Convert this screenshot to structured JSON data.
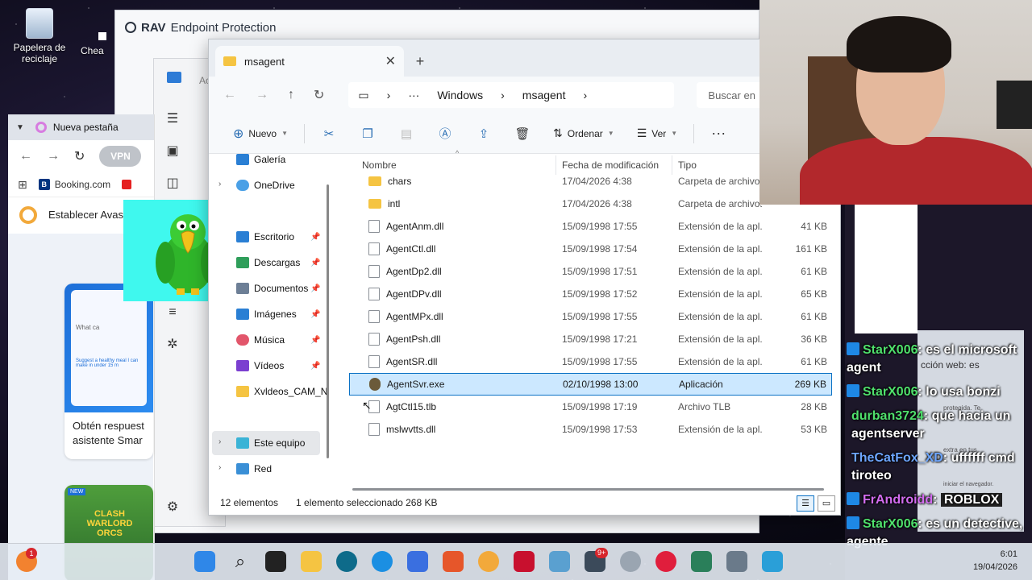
{
  "desktop": {
    "icons": [
      {
        "label": "Papelera de reciclaje"
      },
      {
        "label": "Chea"
      }
    ]
  },
  "rav": {
    "title_brand": "RAV",
    "title_rest": "Endpoint Protection"
  },
  "back_window": {
    "label": "Ac"
  },
  "browser": {
    "tab_label": "Nueva pestaña",
    "vpn_label": "VPN",
    "bookmark": "Booking.com",
    "banner": "Establecer Avas",
    "card_small_text": "What ca",
    "card_mini_text": "Suggest a healthy meal I can make in under 15 m",
    "card_title": "Obtén respuest asistente Smar",
    "game_badge": "NEW",
    "game_title": "CLASH WARLORD ORCS"
  },
  "explorer": {
    "tab_title": "msagent",
    "breadcrumb": [
      "Windows",
      "msagent"
    ],
    "search_placeholder": "Buscar en",
    "toolbar": {
      "new": "Nuevo",
      "sort": "Ordenar",
      "view": "Ver"
    },
    "nav": [
      {
        "label": "Galería"
      },
      {
        "label": "OneDrive"
      },
      {
        "label": "Escritorio"
      },
      {
        "label": "Descargas"
      },
      {
        "label": "Documentos"
      },
      {
        "label": "Imágenes"
      },
      {
        "label": "Música"
      },
      {
        "label": "Vídeos"
      },
      {
        "label": "Xvldeos_CAM_N"
      },
      {
        "label": "Este equipo"
      },
      {
        "label": "Red"
      }
    ],
    "columns": {
      "name": "Nombre",
      "date": "Fecha de modificación",
      "type": "Tipo"
    },
    "files": [
      {
        "name": "chars",
        "date": "17/04/2026 4:38",
        "type": "Carpeta de archivos",
        "size": ""
      },
      {
        "name": "intl",
        "date": "17/04/2026 4:38",
        "type": "Carpeta de archivos",
        "size": ""
      },
      {
        "name": "AgentAnm.dll",
        "date": "15/09/1998 17:55",
        "type": "Extensión de la apl...",
        "size": "41 KB"
      },
      {
        "name": "AgentCtl.dll",
        "date": "15/09/1998 17:54",
        "type": "Extensión de la apl...",
        "size": "161 KB"
      },
      {
        "name": "AgentDp2.dll",
        "date": "15/09/1998 17:51",
        "type": "Extensión de la apl...",
        "size": "61 KB"
      },
      {
        "name": "AgentDPv.dll",
        "date": "15/09/1998 17:52",
        "type": "Extensión de la apl...",
        "size": "65 KB"
      },
      {
        "name": "AgentMPx.dll",
        "date": "15/09/1998 17:55",
        "type": "Extensión de la apl...",
        "size": "61 KB"
      },
      {
        "name": "AgentPsh.dll",
        "date": "15/09/1998 17:21",
        "type": "Extensión de la apl...",
        "size": "36 KB"
      },
      {
        "name": "AgentSR.dll",
        "date": "15/09/1998 17:55",
        "type": "Extensión de la apl...",
        "size": "61 KB"
      },
      {
        "name": "AgentSvr.exe",
        "date": "02/10/1998 13:00",
        "type": "Aplicación",
        "size": "269 KB"
      },
      {
        "name": "AgtCtl15.tlb",
        "date": "15/09/1998 17:19",
        "type": "Archivo TLB",
        "size": "28 KB"
      },
      {
        "name": "mslwvtts.dll",
        "date": "15/09/1998 17:53",
        "type": "Extensión de la apl...",
        "size": "53 KB"
      }
    ],
    "status": {
      "count": "12 elementos",
      "selected": "1 elemento seleccionado  268 KB"
    }
  },
  "chat": {
    "bg_text": [
      "cción web: es",
      "protegida. Te",
      "extra en tus",
      "iniciar el navegador."
    ],
    "messages": [
      {
        "user": "StarX006",
        "sep": ": ",
        "text": "es el microsoft agent"
      },
      {
        "user": "StarX006",
        "sep": ": ",
        "text": "lo usa bonzi"
      },
      {
        "user": "durban3724",
        "sep": ": ",
        "text": "que hacia un agentserver"
      },
      {
        "user": "TheCatFox_XD",
        "sep": ": ",
        "text": "uffffff cmd tiroteo"
      },
      {
        "user": "FrAndroidd",
        "sep": ": ",
        "text": "ROBLOX"
      },
      {
        "user": "StarX006",
        "sep": ": ",
        "text": "es un detective, agente"
      }
    ]
  },
  "taskbar": {
    "notif_badge": "1",
    "app_badge": "9+"
  },
  "tray": {
    "time": "6:01",
    "date": "19/04/2026"
  },
  "colors": {
    "selection": "#cce8ff",
    "selection_border": "#0b72c5",
    "folder": "#f5c442",
    "chat_green": "#4fe06c"
  }
}
